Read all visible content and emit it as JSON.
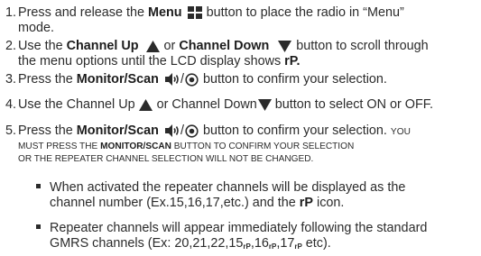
{
  "steps": [
    {
      "number": "1.",
      "line1_before": "Press and release the ",
      "bold": "Menu",
      "line1_after": " button to place the radio in “Menu”",
      "line2": "mode.",
      "icon": "menu-grid-icon"
    },
    {
      "number": "2.",
      "before": "Use the ",
      "bold1": "Channel Up",
      "mid": " or ",
      "bold2": "Channel Down",
      "after": " button to scroll through",
      "line2_before": "the menu options until the LCD display shows ",
      "bold3": "rP.",
      "icons": [
        "triangle-up-icon",
        "triangle-down-icon"
      ]
    },
    {
      "number": "3.",
      "before": "Press the ",
      "bold": "Monitor/Scan",
      "after": " button to confirm your selection.",
      "separator": "/",
      "icons": [
        "speaker-icon",
        "scan-icon"
      ]
    },
    {
      "number": "4.",
      "before": "Use the Channel Up ",
      "mid": " or Channel Down",
      "after": " button to select ON or OFF.",
      "icons": [
        "triangle-up-icon",
        "triangle-down-icon"
      ]
    },
    {
      "number": "5.",
      "before": "Press the ",
      "bold": "Monitor/Scan",
      "after": " button to confirm your selection. ",
      "separator": "/",
      "caps1": "YOU",
      "caps2_before": "MUST PRESS THE ",
      "caps2_bold": "MONITOR/SCAN",
      "caps2_after": " BUTTON TO CONFIRM YOUR SELECTION",
      "caps3": "OR THE REPEATER CHANNEL SELECTION WILL NOT BE CHANGED.",
      "icons": [
        "speaker-icon",
        "scan-icon"
      ]
    }
  ],
  "bullets": [
    {
      "line1": "When activated the repeater channels will be displayed as the",
      "line2_before": "channel number (Ex.15,16,17,etc.) and the ",
      "line2_bold": "rP",
      "line2_after": " icon."
    },
    {
      "line1": "Repeater channels will appear immediately following the standard",
      "line2_before": "GMRS channels (Ex: 20,21,22,15",
      "seq": [
        "16",
        "17"
      ],
      "sep": ",",
      "line2_end": " etc).",
      "sub": "rP"
    }
  ]
}
